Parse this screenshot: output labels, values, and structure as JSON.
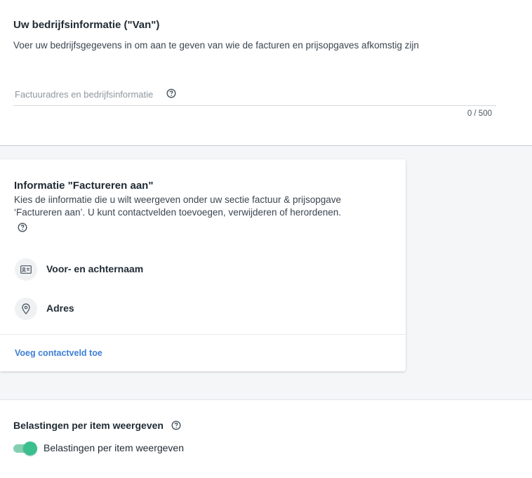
{
  "from_section": {
    "title": "Uw bedrijfsinformatie (\"Van\")",
    "subtitle": "Voer uw bedrijfsgegevens in om aan te geven van wie de facturen en prijsopgaves afkomstig zijn",
    "field_label": "Factuuradres en bedrijfsinformatie",
    "counter": "0 / 500"
  },
  "bill_to_card": {
    "title": "Informatie \"Factureren aan\"",
    "description": "Kies de iinformatie die u wilt weergeven onder uw sectie factuur & prijsopgave ‘Factureren aan’. U kunt contactvelden toevoegen, verwijderen of herordenen.",
    "contacts": [
      {
        "label": "Voor- en achternaam",
        "icon": "contact-card-icon"
      },
      {
        "label": "Adres",
        "icon": "location-pin-icon"
      }
    ],
    "add_link": "Voeg contactveld toe"
  },
  "tax_section": {
    "title": "Belastingen per item weergeven",
    "toggle_label": "Belastingen per item weergeven",
    "toggle_on": true
  },
  "colors": {
    "accent_link": "#3d7fd6",
    "toggle_on": "#3cbf8f"
  }
}
